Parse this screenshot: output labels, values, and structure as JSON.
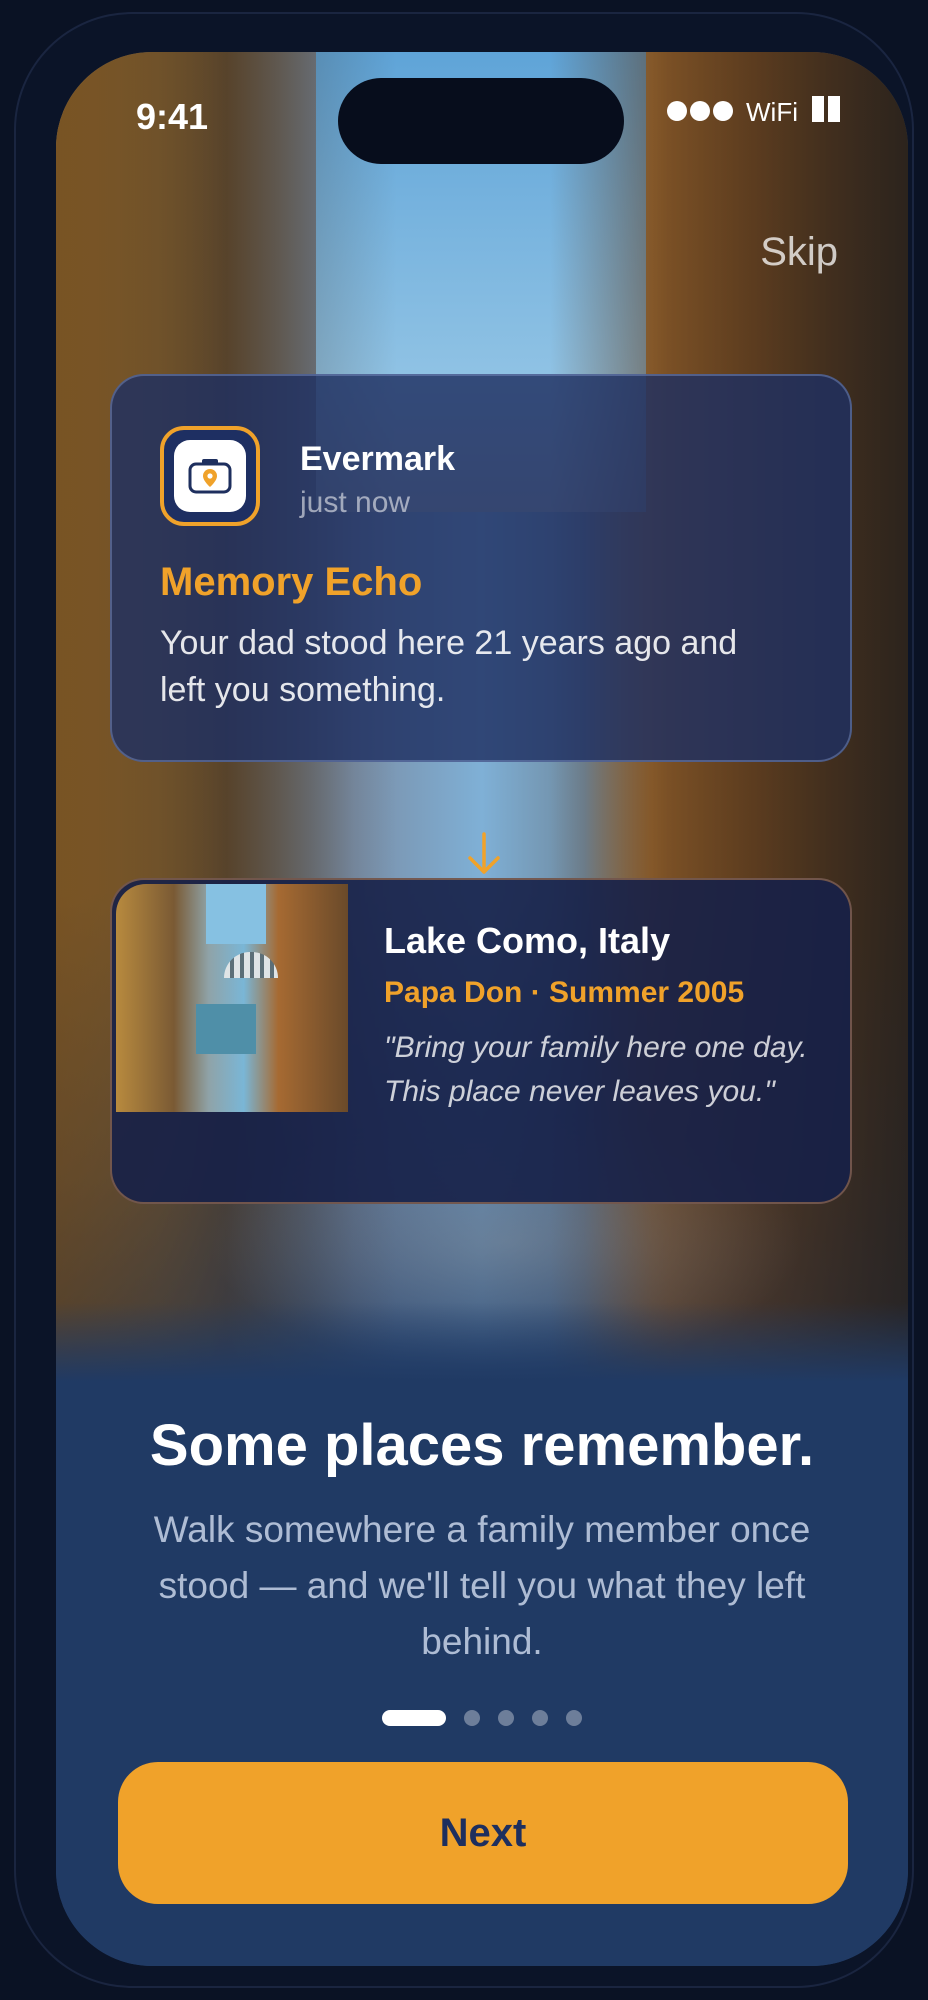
{
  "status_bar": {
    "time": "9:41",
    "network": "WiFi"
  },
  "header": {
    "skip_label": "Skip"
  },
  "notification": {
    "app_name": "Evermark",
    "time": "just now",
    "title": "Memory Echo",
    "body": "Your dad stood here 21 years ago and left you something."
  },
  "memory_card": {
    "place": "Lake Como, Italy",
    "meta": "Papa Don · Summer 2005",
    "quote": "\"Bring your family here one day. This place never leaves you.\""
  },
  "onboarding": {
    "headline": "Some places remember.",
    "subtext": "Walk somewhere a family member once stood — and we'll tell you what they left behind.",
    "page_index": 1,
    "page_count": 5
  },
  "actions": {
    "next_label": "Next"
  },
  "colors": {
    "accent": "#f0a22a",
    "panel": "#203a64",
    "text_dark": "#1e2f5e"
  },
  "icons": {
    "app_icon": "camera-pin-icon",
    "arrow": "arrow-down-icon"
  }
}
